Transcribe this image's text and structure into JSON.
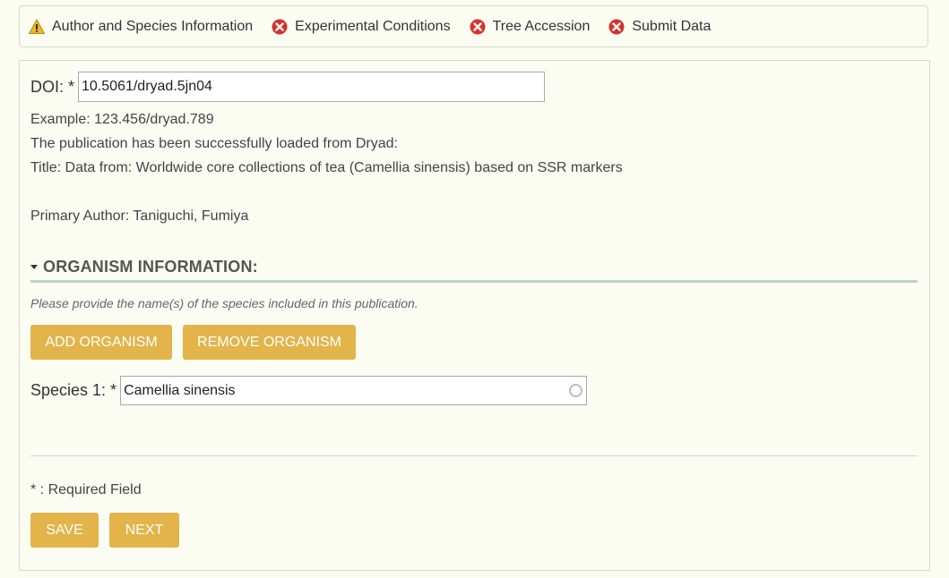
{
  "steps": [
    {
      "label": "Author and Species Information",
      "status": "warning"
    },
    {
      "label": "Experimental Conditions",
      "status": "error"
    },
    {
      "label": "Tree Accession",
      "status": "error"
    },
    {
      "label": "Submit Data",
      "status": "error"
    }
  ],
  "doi": {
    "label": "DOI: *",
    "value": "10.5061/dryad.5jn04",
    "example": "Example: 123.456/dryad.789",
    "loaded_message": "The publication has been successfully loaded from Dryad:",
    "title": "Title: Data from: Worldwide core collections of tea (Camellia sinensis) based on SSR markers",
    "primary_author": "Primary Author: Taniguchi, Fumiya"
  },
  "organism": {
    "section_title": "ORGANISM INFORMATION:",
    "hint": "Please provide the name(s) of the species included in this publication.",
    "add_label": "ADD ORGANISM",
    "remove_label": "REMOVE ORGANISM",
    "species_label": "Species 1: *",
    "species_value": "Camellia sinensis"
  },
  "footer": {
    "required_note": "* : Required Field",
    "save_label": "SAVE",
    "next_label": "NEXT"
  },
  "colors": {
    "button": "#e2b44a",
    "warning": "#e8b923",
    "error": "#d9312b",
    "section_rule": "#b7d6cc"
  },
  "icons": {
    "warning": "warning-icon",
    "error": "error-icon",
    "caret": "caret-down-icon",
    "spinner": "loading-spinner-icon"
  }
}
